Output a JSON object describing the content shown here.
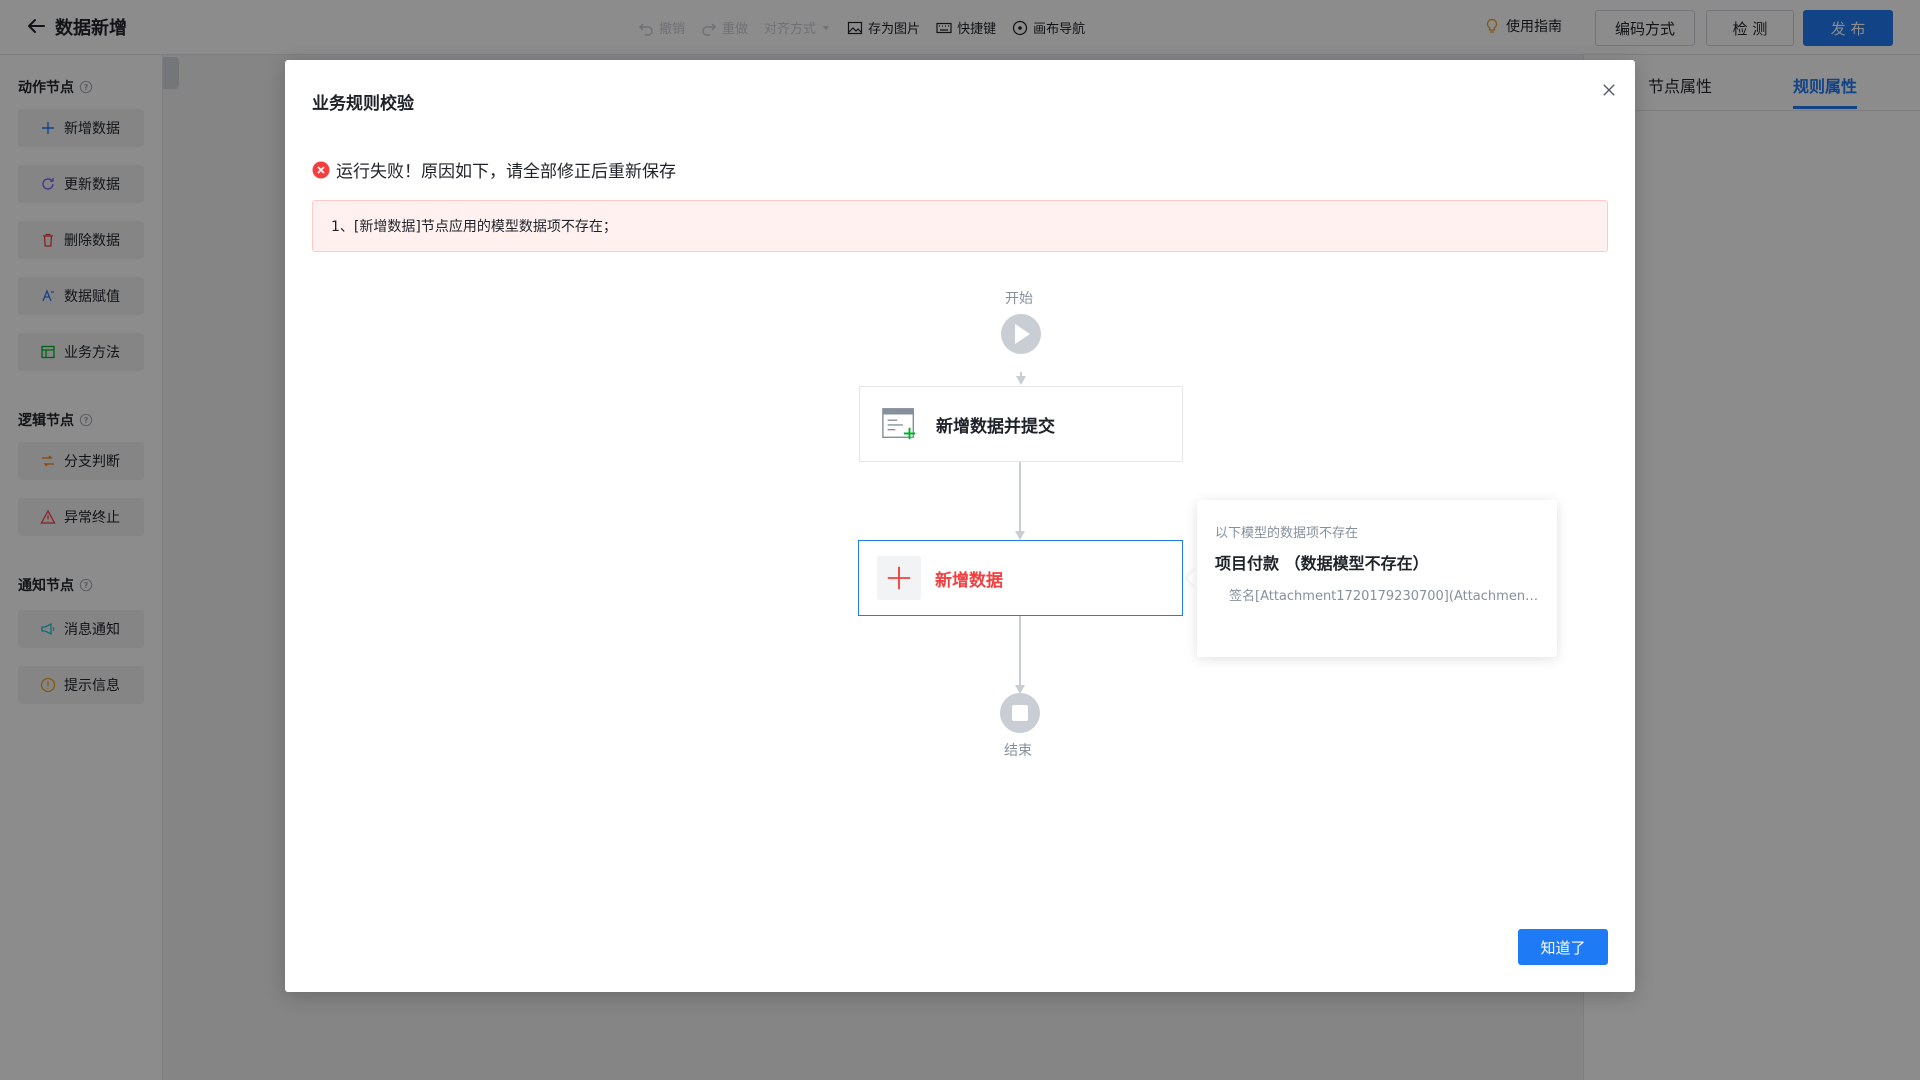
{
  "header": {
    "title": "数据新增",
    "toolbar": {
      "undo": "撤销",
      "redo": "重做",
      "align": "对齐方式",
      "save_image": "存为图片",
      "shortcuts": "快捷键",
      "canvas_nav": "画布导航"
    },
    "guide": "使用指南",
    "encode_button": "编码方式",
    "check_button": "检 测",
    "publish_button": "发 布"
  },
  "palette": {
    "groups": [
      {
        "title": "动作节点",
        "items": [
          {
            "label": "新增数据",
            "icon": "plus-icon"
          },
          {
            "label": "更新数据",
            "icon": "refresh-icon"
          },
          {
            "label": "删除数据",
            "icon": "trash-icon"
          },
          {
            "label": "数据赋值",
            "icon": "assign-icon"
          },
          {
            "label": "业务方法",
            "icon": "method-icon"
          }
        ]
      },
      {
        "title": "逻辑节点",
        "items": [
          {
            "label": "分支判断",
            "icon": "branch-icon"
          },
          {
            "label": "异常终止",
            "icon": "warning-icon"
          }
        ]
      },
      {
        "title": "通知节点",
        "items": [
          {
            "label": "消息通知",
            "icon": "megaphone-icon"
          },
          {
            "label": "提示信息",
            "icon": "info-icon"
          }
        ]
      }
    ]
  },
  "right_panel": {
    "tabs": [
      "节点属性",
      "规则属性"
    ],
    "active_tab": "规则属性"
  },
  "modal": {
    "title": "业务规则校验",
    "error_message": "运行失败！原因如下，请全部修正后重新保存",
    "error_list": [
      "1、[新增数据]节点应用的模型数据项不存在；"
    ],
    "flow": {
      "start_label": "开始",
      "end_label": "结束",
      "nodes": [
        {
          "label": "新增数据并提交",
          "icon": "form-add-icon"
        },
        {
          "label": "新增数据",
          "icon": "plus-icon",
          "status": "error"
        }
      ]
    },
    "tooltip": {
      "heading": "以下模型的数据项不存在",
      "title": "项目付款 （数据模型不存在）",
      "detail": "签名[Attachment1720179230700](Attachment17..."
    },
    "ok_button": "知道了"
  },
  "colors": {
    "primary": "#1f7af5",
    "error": "#f53f3f",
    "error_bg": "#fff1f0"
  }
}
